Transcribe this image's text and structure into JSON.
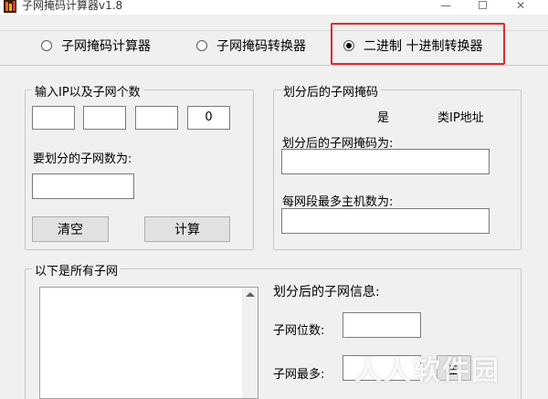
{
  "window": {
    "title": "子网掩码计算器v1.8",
    "min_glyph": "—",
    "close_glyph": "✕"
  },
  "mode_tabs": [
    {
      "label": "子网掩码计算器",
      "selected": false
    },
    {
      "label": "子网掩码转换器",
      "selected": false
    },
    {
      "label": "二进制 十进制转换器",
      "selected": true
    }
  ],
  "input_group": {
    "legend": "输入IP以及子网个数",
    "ip_octets": [
      "",
      "",
      "",
      "0"
    ],
    "subnet_count_label": "要划分的子网数为:",
    "subnet_count_value": "",
    "clear_button": "清空",
    "calc_button": "计算"
  },
  "mask_group": {
    "legend": "划分后的子网掩码",
    "is_label": "是",
    "class_label": "类IP地址",
    "mask_label": "划分后的子网掩码为:",
    "mask_value": "",
    "hosts_label": "每网段最多主机数为:",
    "hosts_value": ""
  },
  "subnets_group": {
    "legend": "以下是所有子网"
  },
  "info": {
    "heading": "划分后的子网信息:",
    "bits_label": "子网位数:",
    "bits_value": "",
    "max_label": "子网最多:",
    "note_button": "注!"
  },
  "watermark": "人人软件园",
  "colors": {
    "highlight": "#e0282d",
    "background": "#f0f0f0"
  }
}
